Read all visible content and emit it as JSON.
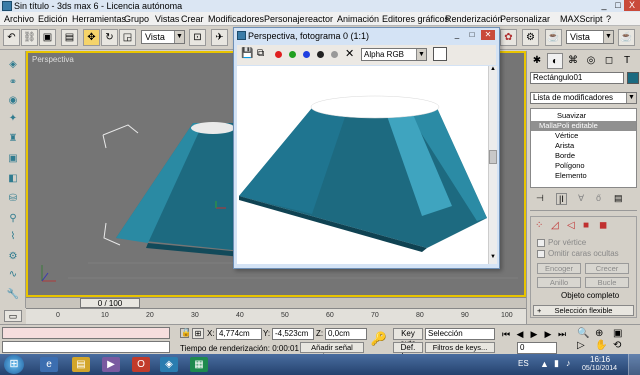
{
  "window": {
    "title": "Sin título - 3ds max 6 - Licencia autónoma",
    "min": "_",
    "max": "□",
    "close": "X"
  },
  "menubar": [
    "Archivo",
    "Edición",
    "Herramientas",
    "Grupo",
    "Vistas",
    "Crear",
    "Modificadores",
    "Personaje",
    "reactor",
    "Animación",
    "Editores gráficos",
    "Renderización",
    "Personalizar",
    "MAXScript",
    "?"
  ],
  "toolbar": {
    "view_select": "Vista",
    "view_select_right": "Vista"
  },
  "viewport": {
    "label": "Perspectiva"
  },
  "timeline": {
    "slider": "0 / 100",
    "ticks": [
      "0",
      "10",
      "20",
      "30",
      "40",
      "50",
      "60",
      "70",
      "80",
      "90",
      "100"
    ]
  },
  "status": {
    "x_label": "X:",
    "x_value": "4,774cm",
    "y_label": "Y:",
    "y_value": "-4,523cm",
    "z_label": "Z:",
    "z_value": "0,0cm",
    "render_time": "Tiempo de renderización: 0:00:01",
    "add_time_tag": "Añadir señal tiempo",
    "key_auto": "Key auto",
    "selection": "Selección",
    "set_key": "Def. key",
    "key_filters": "Filtros de keys...",
    "frame": "0"
  },
  "render_window": {
    "title": "Perspectiva, fotograma 0 (1:1)",
    "channel": "Alpha RGB",
    "colors": {
      "red": "#e02020",
      "green": "#20a020",
      "blue": "#2040e0"
    }
  },
  "command_panel": {
    "object_name": "Rectángulo01",
    "object_color": "#1a6a80",
    "modifier_list": "Lista de modificadores",
    "stack": [
      {
        "label": "Suavizar",
        "selected": false,
        "indent": 1
      },
      {
        "label": "MallaPoli editable",
        "selected": true,
        "indent": 0
      },
      {
        "label": "Vértice",
        "selected": false,
        "indent": 2
      },
      {
        "label": "Arista",
        "selected": false,
        "indent": 2
      },
      {
        "label": "Borde",
        "selected": false,
        "indent": 2
      },
      {
        "label": "Polígono",
        "selected": false,
        "indent": 2
      },
      {
        "label": "Elemento",
        "selected": false,
        "indent": 2
      }
    ],
    "by_vertex": "Por vértice",
    "ignore_backfacing": "Omitir caras ocultas",
    "shrink": "Encoger",
    "grow": "Crecer",
    "ring": "Anillo",
    "loop": "Bucle",
    "whole_object": "Objeto completo",
    "soft_selection": "Selección flexible"
  },
  "taskbar": {
    "language": "ES",
    "time": "16:16",
    "date": "05/10/2014"
  }
}
